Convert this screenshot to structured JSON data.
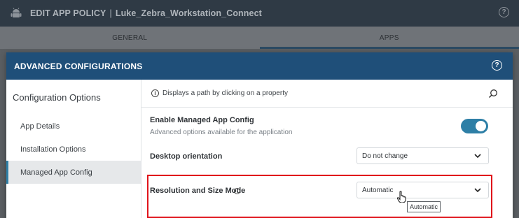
{
  "app": {
    "title": "EDIT APP POLICY",
    "separator": "|",
    "policy_name": "Luke_Zebra_Workstation_Connect",
    "help_glyph": "?"
  },
  "bg_tabs": [
    {
      "label": "GENERAL"
    },
    {
      "label": "APPS"
    }
  ],
  "modal": {
    "title": "ADVANCED CONFIGURATIONS",
    "help_glyph": "?",
    "sidebar": {
      "title": "Configuration Options",
      "items": [
        {
          "label": "App Details"
        },
        {
          "label": "Installation Options"
        },
        {
          "label": "Managed App Config",
          "active": true
        }
      ]
    },
    "path_bar": {
      "text": "Displays a path by clicking on a property"
    },
    "fields": {
      "managed_config": {
        "label": "Enable Managed App Config",
        "description": "Advanced options available for the application",
        "enabled": true
      },
      "desktop_orientation": {
        "label": "Desktop orientation",
        "value": "Do not change"
      },
      "resolution": {
        "label": "Resolution and Size Mode",
        "value": "Automatic",
        "tooltip": "Automatic"
      }
    }
  },
  "colors": {
    "modal_header": "#1f4f79",
    "accent": "#2e7fa6",
    "highlight": "#e0141b"
  }
}
